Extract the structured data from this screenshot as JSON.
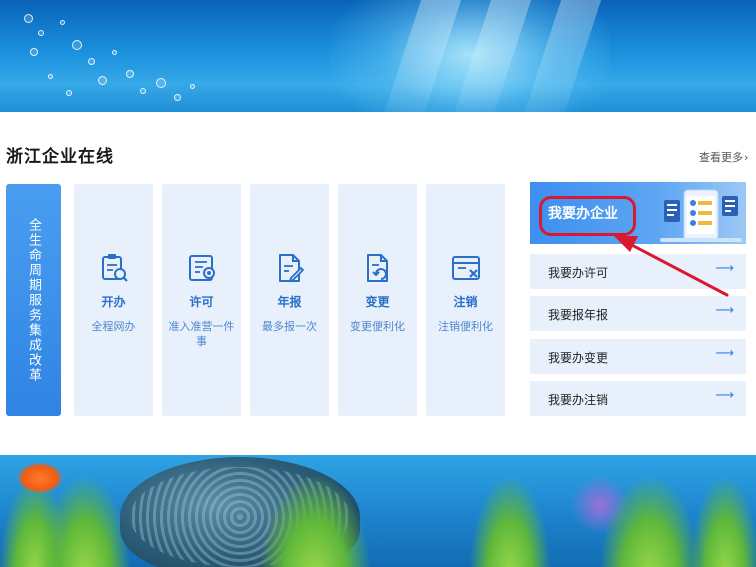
{
  "section": {
    "title": "浙江企业在线",
    "more_label": "查看更多"
  },
  "reform_banner": {
    "text": "全生命周期服务集成改革"
  },
  "cards": [
    {
      "name": "开办",
      "desc": "全程网办",
      "icon": "clipboard-search-icon"
    },
    {
      "name": "许可",
      "desc": "准入准营一件事",
      "icon": "certificate-icon"
    },
    {
      "name": "年报",
      "desc": "最多报一次",
      "icon": "document-edit-icon"
    },
    {
      "name": "变更",
      "desc": "变更便利化",
      "icon": "document-refresh-icon"
    },
    {
      "name": "注销",
      "desc": "注销便利化",
      "icon": "window-close-icon"
    }
  ],
  "feature": {
    "label": "我要办企业"
  },
  "list": [
    {
      "label": "我要办许可"
    },
    {
      "label": "我要报年报"
    },
    {
      "label": "我要办变更"
    },
    {
      "label": "我要办注销"
    }
  ],
  "colors": {
    "accent_blue": "#2f84e4",
    "card_bg": "#e8f1fb",
    "annotation_red": "#d8192f"
  }
}
